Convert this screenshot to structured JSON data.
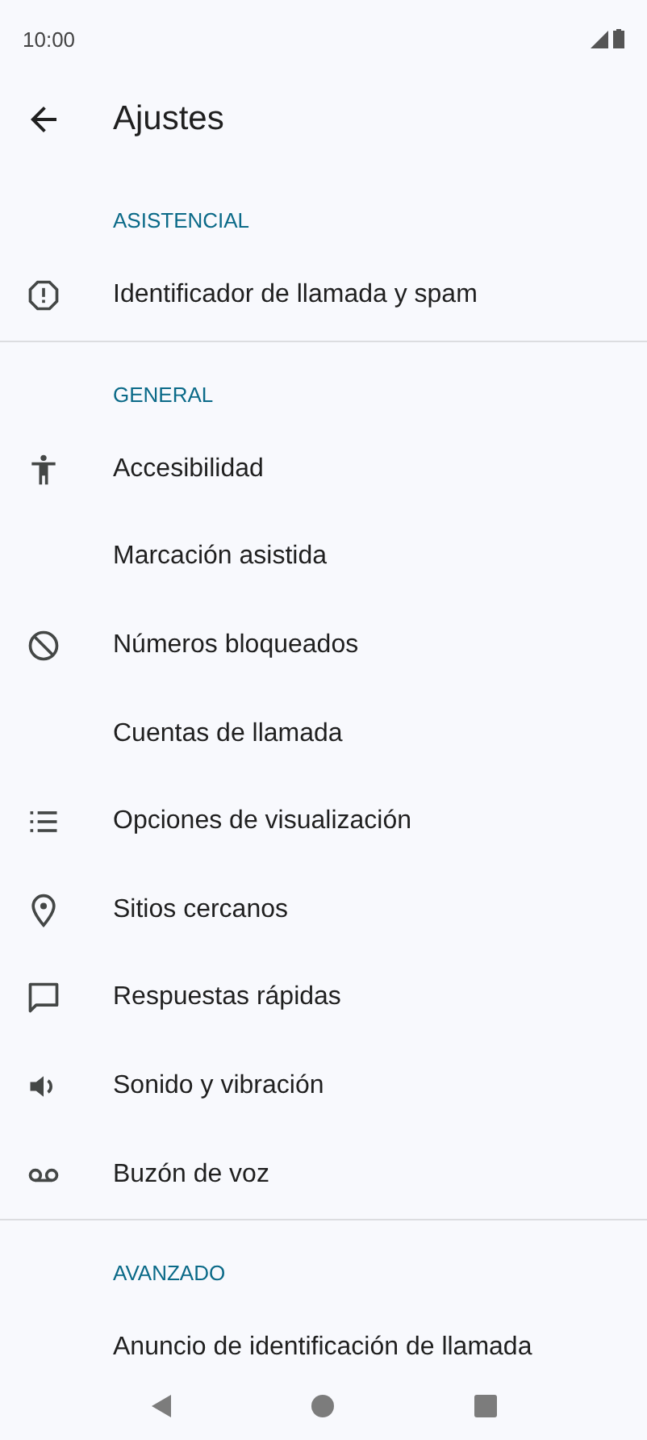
{
  "status_bar": {
    "time": "10:00"
  },
  "app_bar": {
    "title": "Ajustes"
  },
  "sections": [
    {
      "header": "ASISTENCIAL",
      "items": [
        {
          "label": "Identificador de llamada y spam",
          "kind": "alert"
        }
      ]
    },
    {
      "header": "GENERAL",
      "items": [
        {
          "label": "Accesibilidad",
          "kind": "accessibility"
        },
        {
          "label": "Marcación asistida",
          "kind": "plain"
        },
        {
          "label": "Números bloqueados",
          "kind": "block"
        },
        {
          "label": "Cuentas de llamada",
          "kind": "plain"
        },
        {
          "label": "Opciones de visualización",
          "kind": "list"
        },
        {
          "label": "Sitios cercanos",
          "kind": "pin"
        },
        {
          "label": "Respuestas rápidas",
          "kind": "chat"
        },
        {
          "label": "Sonido y vibración",
          "kind": "volume"
        },
        {
          "label": "Buzón de voz",
          "kind": "voicemail"
        }
      ]
    },
    {
      "header": "AVANZADO",
      "items": [
        {
          "label": "Anuncio de identificación de llamada",
          "kind": "plain"
        }
      ]
    }
  ]
}
